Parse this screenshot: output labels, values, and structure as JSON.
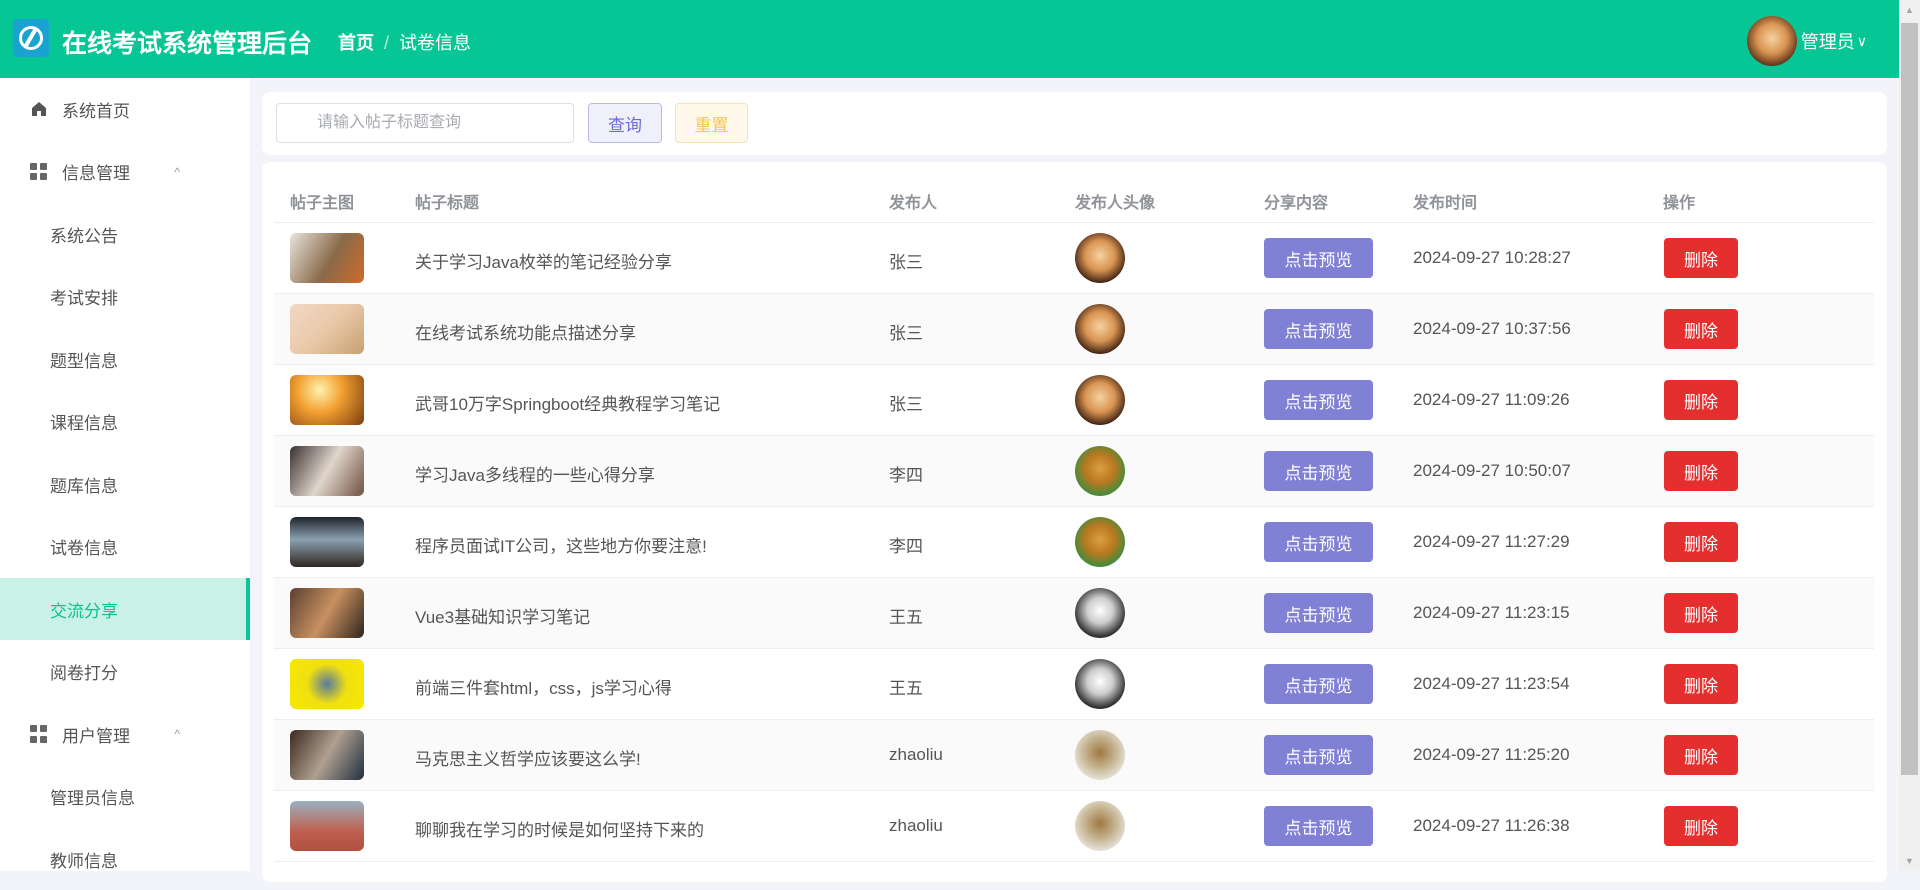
{
  "header": {
    "title": "在线考试系统管理后台",
    "breadcrumb": [
      "首页",
      "试卷信息"
    ],
    "separator": "/",
    "user": "管理员",
    "user_chevron": "∨"
  },
  "colors": {
    "brand": "#07c695",
    "preview": "#8080d4",
    "delete": "#e52e2e"
  },
  "sidebar": {
    "items": [
      {
        "label": "系统首页",
        "type": "top",
        "icon": "home-icon"
      },
      {
        "label": "信息管理",
        "type": "group",
        "icon": "grid-icon",
        "chevron": "^"
      },
      {
        "label": "系统公告",
        "type": "sub"
      },
      {
        "label": "考试安排",
        "type": "sub"
      },
      {
        "label": "题型信息",
        "type": "sub"
      },
      {
        "label": "课程信息",
        "type": "sub"
      },
      {
        "label": "题库信息",
        "type": "sub"
      },
      {
        "label": "试卷信息",
        "type": "sub"
      },
      {
        "label": "交流分享",
        "type": "sub",
        "active": true
      },
      {
        "label": "阅卷打分",
        "type": "sub"
      },
      {
        "label": "用户管理",
        "type": "group",
        "icon": "grid-icon",
        "chevron": "^"
      },
      {
        "label": "管理员信息",
        "type": "sub"
      },
      {
        "label": "教师信息",
        "type": "sub"
      }
    ]
  },
  "search": {
    "placeholder": "请输入帖子标题查询",
    "value": "",
    "query_label": "查询",
    "reset_label": "重置"
  },
  "table": {
    "columns": [
      "帖子主图",
      "帖子标题",
      "发布人",
      "发布人头像",
      "分享内容",
      "发布时间",
      "操作"
    ],
    "preview_label": "点击预览",
    "delete_label": "删除",
    "rows": [
      {
        "title": "关于学习Java枚举的笔记经验分享",
        "author": "张三",
        "time": "2024-09-27 10:28:27",
        "avatar": "shiba",
        "thumb": "t1"
      },
      {
        "title": "在线考试系统功能点描述分享",
        "author": "张三",
        "time": "2024-09-27 10:37:56",
        "avatar": "shiba",
        "thumb": "t2"
      },
      {
        "title": "武哥10万字Springboot经典教程学习笔记",
        "author": "张三",
        "time": "2024-09-27 11:09:26",
        "avatar": "shiba",
        "thumb": "t3"
      },
      {
        "title": "学习Java多线程的一些心得分享",
        "author": "李四",
        "time": "2024-09-27 10:50:07",
        "avatar": "golden",
        "thumb": "t4"
      },
      {
        "title": "程序员面试IT公司，这些地方你要注意!",
        "author": "李四",
        "time": "2024-09-27 11:27:29",
        "avatar": "golden",
        "thumb": "t5"
      },
      {
        "title": "Vue3基础知识学习笔记",
        "author": "王五",
        "time": "2024-09-27 11:23:15",
        "avatar": "cat",
        "thumb": "t6"
      },
      {
        "title": "前端三件套html，css，js学习心得",
        "author": "王五",
        "time": "2024-09-27 11:23:54",
        "avatar": "cat",
        "thumb": "t7"
      },
      {
        "title": "马克思主义哲学应该要这么学!",
        "author": "zhaoliu",
        "time": "2024-09-27 11:25:20",
        "avatar": "bengal",
        "thumb": "t8"
      },
      {
        "title": "聊聊我在学习的时候是如何坚持下来的",
        "author": "zhaoliu",
        "time": "2024-09-27 11:26:38",
        "avatar": "bengal",
        "thumb": "t9"
      }
    ]
  }
}
